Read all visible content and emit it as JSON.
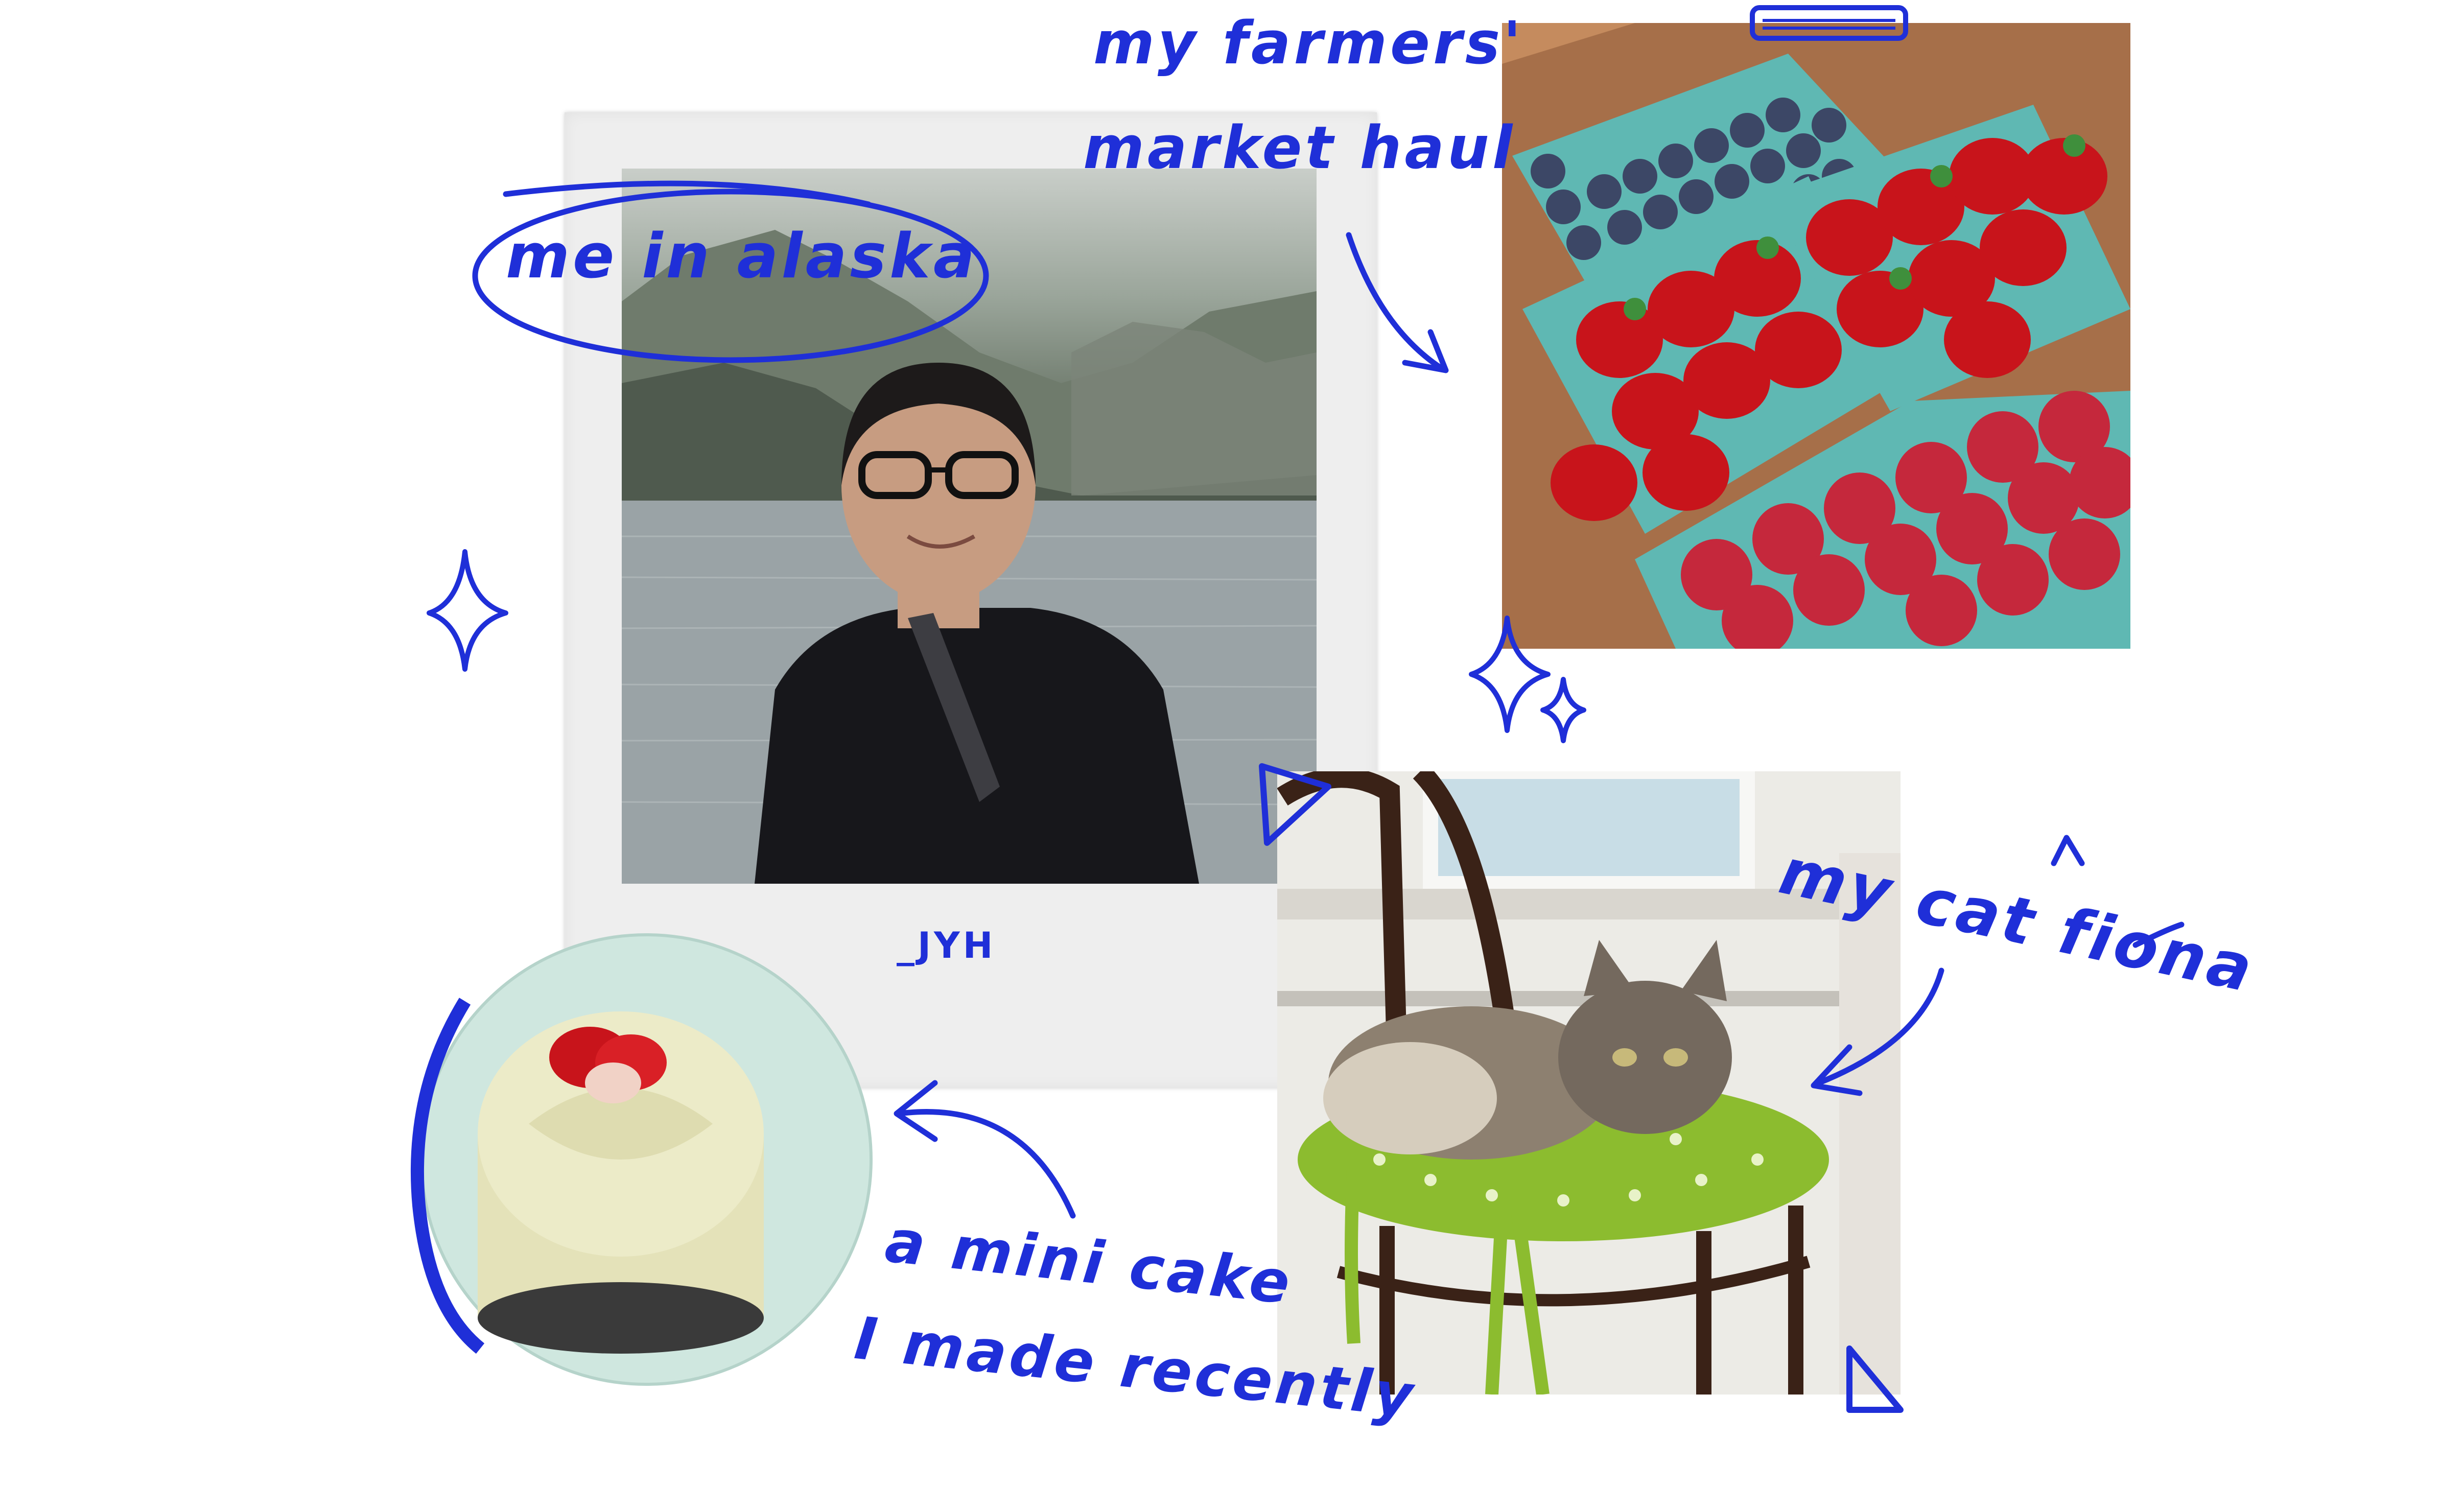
{
  "notes": {
    "alaska": "me in alaska",
    "market_line1": "my farmers'",
    "market_line2": "market haul",
    "cat": "my cat fiona",
    "cake_line1": "a mini cake",
    "cake_line2": "I made recently"
  },
  "polaroid": {
    "caption": "_JYH"
  },
  "colors": {
    "ink": "#1f2fd8",
    "polaroid_frame": "#ececec",
    "water": "#8c979b",
    "mountains": "#5f6b5e",
    "jacket": "#17171b",
    "strawberry": "#c8141b",
    "raspberry": "#c5283c",
    "blueberry": "#3c4766",
    "carton": "#5fb8b3",
    "box": "#b97d53",
    "cake_frosting": "#e4e2b9",
    "plate": "#cfe7df",
    "cushion": "#8cbc2f",
    "chair": "#3a2217"
  },
  "icons": [
    "sparkle-icon",
    "arrow-icon",
    "triangle-icon",
    "tape-icon"
  ]
}
